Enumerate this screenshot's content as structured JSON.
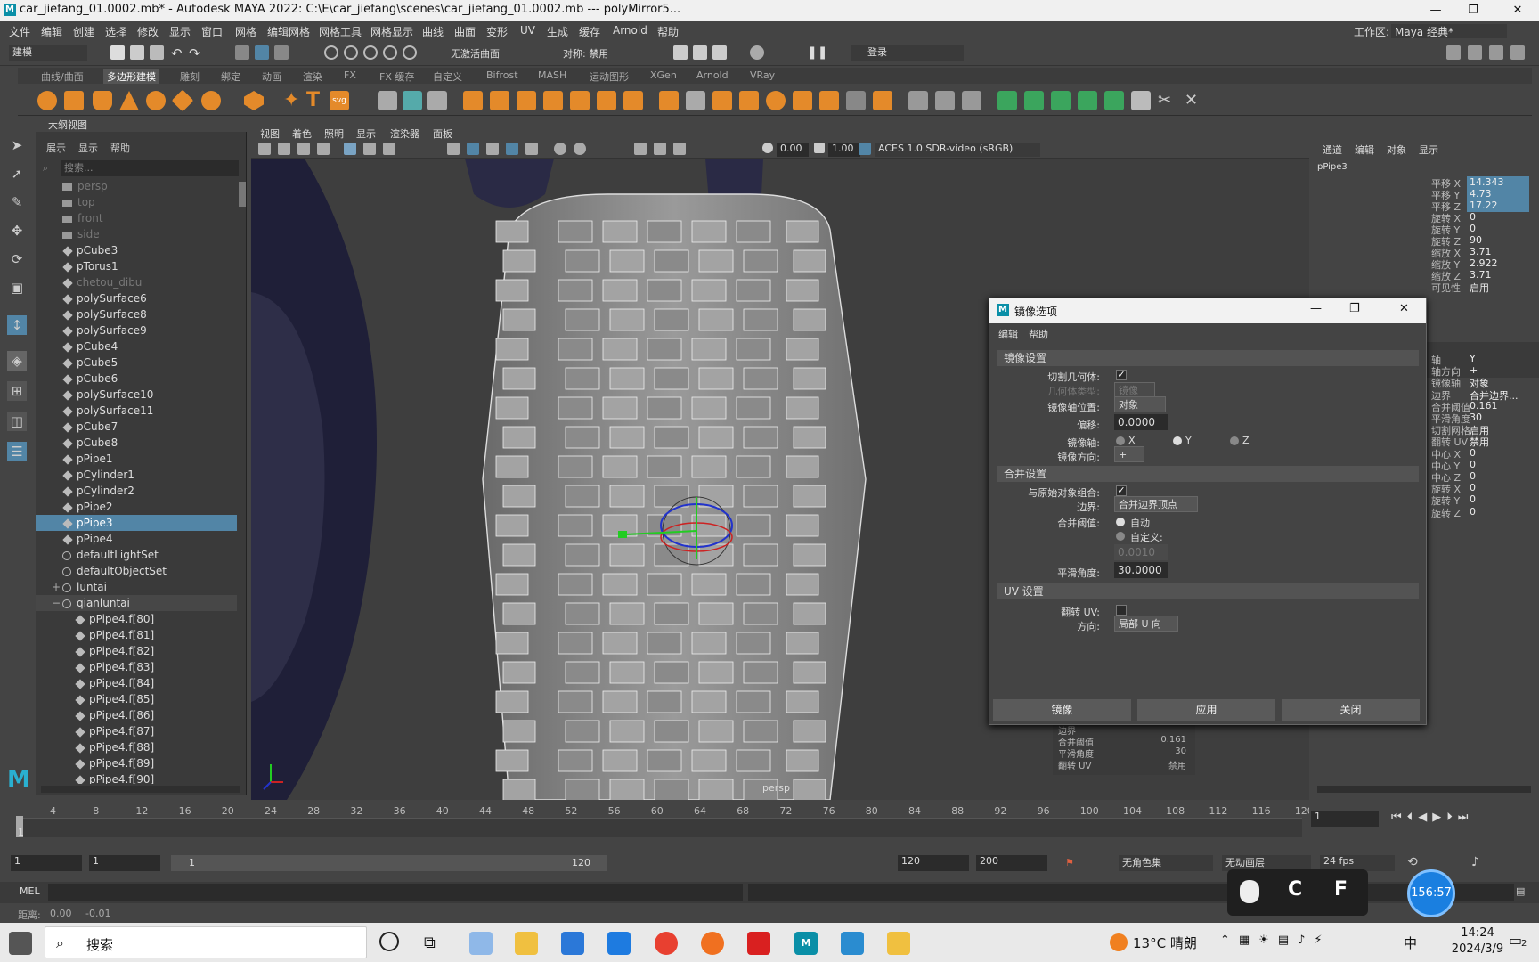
{
  "window": {
    "title": "car_jiefang_01.0002.mb* - Autodesk MAYA 2022: C:\\E\\car_jiefang\\scenes\\car_jiefang_01.0002.mb   ---   polyMirror5...",
    "min": "—",
    "max": "❐",
    "close": "✕"
  },
  "menubar": [
    "文件",
    "编辑",
    "创建",
    "选择",
    "修改",
    "显示",
    "窗口",
    "网格",
    "编辑网格",
    "网格工具",
    "网格显示",
    "曲线",
    "曲面",
    "变形",
    "UV",
    "生成",
    "缓存",
    "Arnold",
    "帮助"
  ],
  "workspace": {
    "label": "工作区:",
    "value": "Maya 经典*"
  },
  "statusline": {
    "mode": "建模",
    "mirror": "无激活曲面",
    "symmetry": "对称: 禁用",
    "login": "登录"
  },
  "shelf_tabs": [
    "曲线/曲面",
    "多边形建模",
    "雕刻",
    "绑定",
    "动画",
    "渲染",
    "FX",
    "FX 缓存",
    "自定义",
    "Bifrost",
    "MASH",
    "运动图形",
    "XGen",
    "Arnold",
    "VRay"
  ],
  "outliner": {
    "title": "大纲视图",
    "menus": [
      "展示",
      "显示",
      "帮助"
    ],
    "search_placeholder": "搜索...",
    "items": [
      {
        "label": "persp",
        "kind": "cam",
        "dim": true
      },
      {
        "label": "top",
        "kind": "cam",
        "dim": true
      },
      {
        "label": "front",
        "kind": "cam",
        "dim": true
      },
      {
        "label": "side",
        "kind": "cam",
        "dim": true
      },
      {
        "label": "pCube3",
        "kind": "mesh"
      },
      {
        "label": "pTorus1",
        "kind": "mesh"
      },
      {
        "label": "chetou_dibu",
        "kind": "mesh",
        "dim": true
      },
      {
        "label": "polySurface6",
        "kind": "mesh"
      },
      {
        "label": "polySurface8",
        "kind": "mesh"
      },
      {
        "label": "polySurface9",
        "kind": "mesh"
      },
      {
        "label": "pCube4",
        "kind": "mesh"
      },
      {
        "label": "pCube5",
        "kind": "mesh"
      },
      {
        "label": "pCube6",
        "kind": "mesh"
      },
      {
        "label": "polySurface10",
        "kind": "mesh"
      },
      {
        "label": "polySurface11",
        "kind": "mesh"
      },
      {
        "label": "pCube7",
        "kind": "mesh"
      },
      {
        "label": "pCube8",
        "kind": "mesh"
      },
      {
        "label": "pPipe1",
        "kind": "mesh"
      },
      {
        "label": "pCylinder1",
        "kind": "mesh"
      },
      {
        "label": "pCylinder2",
        "kind": "mesh"
      },
      {
        "label": "pPipe2",
        "kind": "mesh"
      },
      {
        "label": "pPipe3",
        "kind": "mesh",
        "selected": true
      },
      {
        "label": "pPipe4",
        "kind": "mesh"
      },
      {
        "label": "defaultLightSet",
        "kind": "set"
      },
      {
        "label": "defaultObjectSet",
        "kind": "set"
      },
      {
        "label": "luntai",
        "kind": "set",
        "expander": "+"
      },
      {
        "label": "qianluntai",
        "kind": "set",
        "expander": "−",
        "group": true
      },
      {
        "label": "pPipe4.f[80]",
        "kind": "mesh",
        "child": true
      },
      {
        "label": "pPipe4.f[81]",
        "kind": "mesh",
        "child": true
      },
      {
        "label": "pPipe4.f[82]",
        "kind": "mesh",
        "child": true
      },
      {
        "label": "pPipe4.f[83]",
        "kind": "mesh",
        "child": true
      },
      {
        "label": "pPipe4.f[84]",
        "kind": "mesh",
        "child": true
      },
      {
        "label": "pPipe4.f[85]",
        "kind": "mesh",
        "child": true
      },
      {
        "label": "pPipe4.f[86]",
        "kind": "mesh",
        "child": true
      },
      {
        "label": "pPipe4.f[87]",
        "kind": "mesh",
        "child": true
      },
      {
        "label": "pPipe4.f[88]",
        "kind": "mesh",
        "child": true
      },
      {
        "label": "pPipe4.f[89]",
        "kind": "mesh",
        "child": true
      },
      {
        "label": "pPipe4.f[90]",
        "kind": "mesh",
        "child": true
      }
    ]
  },
  "viewport": {
    "menus": [
      "视图",
      "着色",
      "照明",
      "显示",
      "渲染器",
      "面板"
    ],
    "exposure": "0.00",
    "gamma": "1.00",
    "colorspace": "ACES 1.0 SDR-video (sRGB)",
    "camera": "persp"
  },
  "channelbox": {
    "menus": [
      "通道",
      "编辑",
      "对象",
      "显示"
    ],
    "object": "pPipe3",
    "channels": [
      {
        "name": "平移 X",
        "value": "14.343",
        "hl": true
      },
      {
        "name": "平移 Y",
        "value": "4.73",
        "hl": true
      },
      {
        "name": "平移 Z",
        "value": "17.22",
        "hl": true
      },
      {
        "name": "旋转 X",
        "value": "0"
      },
      {
        "name": "旋转 Y",
        "value": "0"
      },
      {
        "name": "旋转 Z",
        "value": "90"
      },
      {
        "name": "缩放 X",
        "value": "3.71"
      },
      {
        "name": "缩放 Y",
        "value": "2.922"
      },
      {
        "name": "缩放 Z",
        "value": "3.71"
      },
      {
        "name": "可见性",
        "value": "启用"
      }
    ],
    "mirror_attrs": [
      {
        "name": "轴",
        "value": "Y"
      },
      {
        "name": "轴方向",
        "value": "+"
      },
      {
        "name": "镜像轴",
        "value": "对象"
      },
      {
        "name": "边界",
        "value": "合并边界..."
      },
      {
        "name": "合并阈值",
        "value": "0.161"
      },
      {
        "name": "平滑角度",
        "value": "30"
      },
      {
        "name": "切割网格",
        "value": "启用"
      },
      {
        "name": "翻转 UV",
        "value": "禁用"
      },
      {
        "name": "中心 X",
        "value": "0"
      },
      {
        "name": "中心 Y",
        "value": "0"
      },
      {
        "name": "中心 Z",
        "value": "0"
      },
      {
        "name": "旋转 X",
        "value": "0"
      },
      {
        "name": "旋转 Y",
        "value": "0"
      },
      {
        "name": "旋转 Z",
        "value": "0"
      }
    ]
  },
  "hud": [
    {
      "name": "边界",
      "value": ""
    },
    {
      "name": "合并阈值",
      "value": "0.161"
    },
    {
      "name": "平滑角度",
      "value": "30"
    },
    {
      "name": "翻转 UV",
      "value": "禁用"
    }
  ],
  "dialog": {
    "title": "镜像选项",
    "menus": [
      "编辑",
      "帮助"
    ],
    "sec_mirror": "镜像设置",
    "cut_geometry": "切割几何体:",
    "geometry_type": "几何体类型:",
    "geometry_type_value": "镜像",
    "axis_position": "镜像轴位置:",
    "axis_position_value": "对象",
    "offset": "偏移:",
    "offset_value": "0.0000",
    "mirror_axis": "镜像轴:",
    "axis_x": "X",
    "axis_y": "Y",
    "axis_z": "Z",
    "mirror_direction": "镜像方向:",
    "mirror_direction_value": "+",
    "sec_merge": "合并设置",
    "combine": "与原始对象组合:",
    "border": "边界:",
    "border_value": "合并边界顶点",
    "threshold": "合并阈值:",
    "auto": "自动",
    "custom": "自定义:",
    "custom_value": "0.0010",
    "smoothing": "平滑角度:",
    "smoothing_value": "30.0000",
    "sec_uv": "UV 设置",
    "flip_uv": "翻转 UV:",
    "direction": "方向:",
    "direction_value": "局部 U 向",
    "btn_mirror": "镜像",
    "btn_apply": "应用",
    "btn_close": "关闭"
  },
  "timeline": {
    "ticks": [
      "4",
      "8",
      "12",
      "16",
      "20",
      "24",
      "28",
      "32",
      "36",
      "40",
      "44",
      "48",
      "52",
      "56",
      "60",
      "64",
      "68",
      "72",
      "76",
      "80",
      "84",
      "88",
      "92",
      "96",
      "100",
      "104",
      "108",
      "112",
      "116",
      "120"
    ],
    "current": "1"
  },
  "range": {
    "start": "1",
    "inner_start": "1",
    "slider_start": "1",
    "slider_end": "120",
    "end": "120",
    "outer_end": "200",
    "char_set": "无角色集",
    "anim_layer": "无动画层",
    "fps": "24 fps"
  },
  "mel": {
    "label": "MEL"
  },
  "help": {
    "label": "距离:",
    "v1": "0.00",
    "v2": "-0.01"
  },
  "overlay": {
    "timer": "156:57",
    "keys": [
      "C",
      "F"
    ]
  },
  "taskbar": {
    "search": "搜索",
    "weather": "13°C 晴朗",
    "ime": "中",
    "time": "14:24",
    "date": "2024/3/9",
    "notif": "2"
  }
}
